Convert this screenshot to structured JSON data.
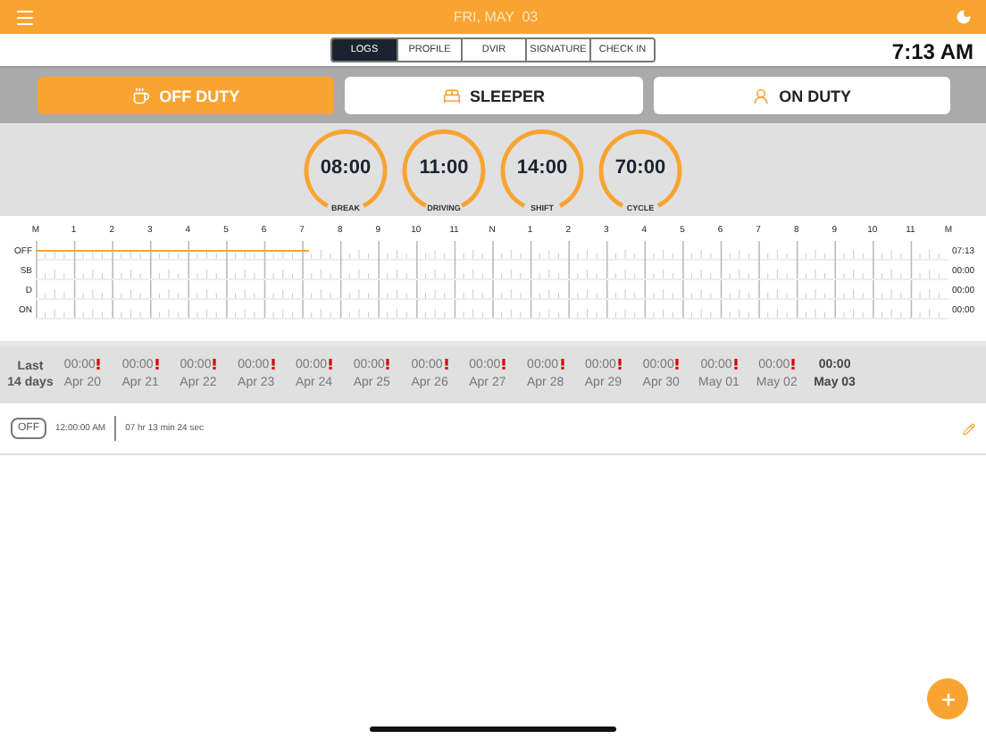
{
  "header": {
    "date": "FRI, MAY  03"
  },
  "tabs": [
    {
      "label": "LOGS",
      "selected": true
    },
    {
      "label": "PROFILE",
      "selected": false
    },
    {
      "label": "DVIR",
      "selected": false
    },
    {
      "label": "SIGNATURE",
      "selected": false
    },
    {
      "label": "CHECK IN",
      "selected": false
    }
  ],
  "clock": "7:13 AM",
  "duty_buttons": [
    {
      "kind": "off",
      "label": "OFF DUTY",
      "selected": true
    },
    {
      "kind": "sleeper",
      "label": "SLEEPER",
      "selected": false
    },
    {
      "kind": "on",
      "label": "ON DUTY",
      "selected": false
    }
  ],
  "gauges": [
    {
      "value": "08:00",
      "label": "BREAK"
    },
    {
      "value": "11:00",
      "label": "DRIVING"
    },
    {
      "value": "14:00",
      "label": "SHIFT"
    },
    {
      "value": "70:00",
      "label": "CYCLE"
    }
  ],
  "grid": {
    "hours": [
      "M",
      "1",
      "2",
      "3",
      "4",
      "5",
      "6",
      "7",
      "8",
      "9",
      "10",
      "11",
      "N",
      "1",
      "2",
      "3",
      "4",
      "5",
      "6",
      "7",
      "8",
      "9",
      "10",
      "11",
      "M"
    ],
    "rows": [
      {
        "label": "OFF",
        "total": "07:13",
        "level": 0.3
      },
      {
        "label": "SB",
        "total": "00:00"
      },
      {
        "label": "D",
        "total": "00:00"
      },
      {
        "label": "ON",
        "total": "00:00"
      }
    ]
  },
  "history": {
    "title": "Last\n14 days",
    "days": [
      {
        "time": "00:00",
        "date": "Apr 20",
        "warning": true,
        "selected": false
      },
      {
        "time": "00:00",
        "date": "Apr 21",
        "warning": true,
        "selected": false
      },
      {
        "time": "00:00",
        "date": "Apr 22",
        "warning": true,
        "selected": false
      },
      {
        "time": "00:00",
        "date": "Apr 23",
        "warning": true,
        "selected": false
      },
      {
        "time": "00:00",
        "date": "Apr 24",
        "warning": true,
        "selected": false
      },
      {
        "time": "00:00",
        "date": "Apr 25",
        "warning": true,
        "selected": false
      },
      {
        "time": "00:00",
        "date": "Apr 26",
        "warning": true,
        "selected": false
      },
      {
        "time": "00:00",
        "date": "Apr 27",
        "warning": true,
        "selected": false
      },
      {
        "time": "00:00",
        "date": "Apr 28",
        "warning": true,
        "selected": false
      },
      {
        "time": "00:00",
        "date": "Apr 29",
        "warning": true,
        "selected": false
      },
      {
        "time": "00:00",
        "date": "Apr 30",
        "warning": true,
        "selected": false
      },
      {
        "time": "00:00",
        "date": "May 01",
        "warning": true,
        "selected": false
      },
      {
        "time": "00:00",
        "date": "May 02",
        "warning": true,
        "selected": false
      },
      {
        "time": "00:00",
        "date": "May 03",
        "warning": false,
        "selected": true
      }
    ]
  },
  "entries": [
    {
      "status": "OFF",
      "time": "12:00:00 AM",
      "duration": "07 hr 13 min 24 sec"
    }
  ]
}
